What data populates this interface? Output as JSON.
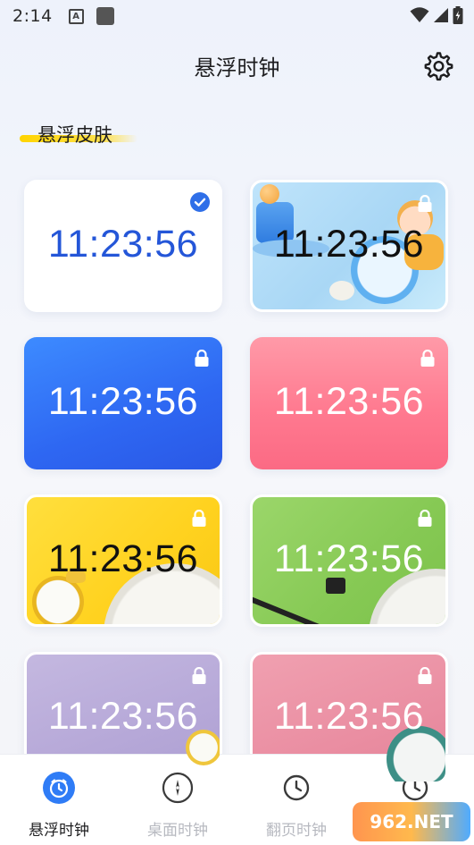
{
  "status_bar": {
    "time": "2:14",
    "notif_letter": "A"
  },
  "header": {
    "title": "悬浮时钟",
    "settings_icon": "gear-icon"
  },
  "section": {
    "title": "悬浮皮肤"
  },
  "skins": [
    {
      "time": "11:23:56",
      "style": "white",
      "selected": true,
      "locked": false,
      "text_color": "#2456d8"
    },
    {
      "time": "11:23:56",
      "style": "3d-illustration",
      "selected": false,
      "locked": true,
      "text_color": "#111111"
    },
    {
      "time": "11:23:56",
      "style": "blue-gradient",
      "selected": false,
      "locked": true,
      "text_color": "#ffffff"
    },
    {
      "time": "11:23:56",
      "style": "pink-gradient",
      "selected": false,
      "locked": true,
      "text_color": "#ffffff"
    },
    {
      "time": "11:23:56",
      "style": "yellow-alarm",
      "selected": false,
      "locked": true,
      "text_color": "#111111"
    },
    {
      "time": "11:23:56",
      "style": "green-photo",
      "selected": false,
      "locked": true,
      "text_color": "#ffffff"
    },
    {
      "time": "11:23:56",
      "style": "purple-photo",
      "selected": false,
      "locked": true,
      "text_color": "#ffffff"
    },
    {
      "time": "11:23:56",
      "style": "rose-photo",
      "selected": false,
      "locked": true,
      "text_color": "#ffffff"
    }
  ],
  "bottom_nav": [
    {
      "label": "悬浮时钟",
      "active": true
    },
    {
      "label": "桌面时钟",
      "active": false
    },
    {
      "label": "翻页时钟",
      "active": false
    },
    {
      "label": "",
      "active": false
    }
  ],
  "watermark": "962.NET",
  "colors": {
    "accent": "#2f7cf6",
    "highlight": "#ffd400"
  }
}
